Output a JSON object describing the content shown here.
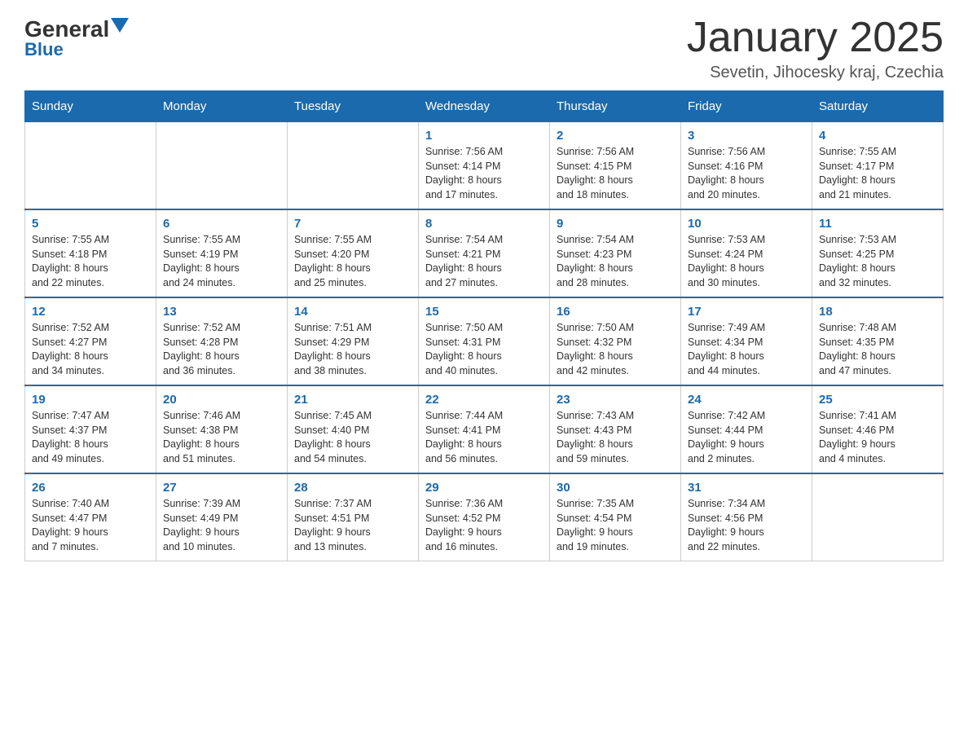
{
  "header": {
    "logo_general": "General",
    "logo_blue": "Blue",
    "month_title": "January 2025",
    "location": "Sevetin, Jihocesky kraj, Czechia"
  },
  "days_of_week": [
    "Sunday",
    "Monday",
    "Tuesday",
    "Wednesday",
    "Thursday",
    "Friday",
    "Saturday"
  ],
  "weeks": [
    {
      "cells": [
        {
          "day": null,
          "info": null
        },
        {
          "day": null,
          "info": null
        },
        {
          "day": null,
          "info": null
        },
        {
          "day": "1",
          "info": "Sunrise: 7:56 AM\nSunset: 4:14 PM\nDaylight: 8 hours\nand 17 minutes."
        },
        {
          "day": "2",
          "info": "Sunrise: 7:56 AM\nSunset: 4:15 PM\nDaylight: 8 hours\nand 18 minutes."
        },
        {
          "day": "3",
          "info": "Sunrise: 7:56 AM\nSunset: 4:16 PM\nDaylight: 8 hours\nand 20 minutes."
        },
        {
          "day": "4",
          "info": "Sunrise: 7:55 AM\nSunset: 4:17 PM\nDaylight: 8 hours\nand 21 minutes."
        }
      ]
    },
    {
      "cells": [
        {
          "day": "5",
          "info": "Sunrise: 7:55 AM\nSunset: 4:18 PM\nDaylight: 8 hours\nand 22 minutes."
        },
        {
          "day": "6",
          "info": "Sunrise: 7:55 AM\nSunset: 4:19 PM\nDaylight: 8 hours\nand 24 minutes."
        },
        {
          "day": "7",
          "info": "Sunrise: 7:55 AM\nSunset: 4:20 PM\nDaylight: 8 hours\nand 25 minutes."
        },
        {
          "day": "8",
          "info": "Sunrise: 7:54 AM\nSunset: 4:21 PM\nDaylight: 8 hours\nand 27 minutes."
        },
        {
          "day": "9",
          "info": "Sunrise: 7:54 AM\nSunset: 4:23 PM\nDaylight: 8 hours\nand 28 minutes."
        },
        {
          "day": "10",
          "info": "Sunrise: 7:53 AM\nSunset: 4:24 PM\nDaylight: 8 hours\nand 30 minutes."
        },
        {
          "day": "11",
          "info": "Sunrise: 7:53 AM\nSunset: 4:25 PM\nDaylight: 8 hours\nand 32 minutes."
        }
      ]
    },
    {
      "cells": [
        {
          "day": "12",
          "info": "Sunrise: 7:52 AM\nSunset: 4:27 PM\nDaylight: 8 hours\nand 34 minutes."
        },
        {
          "day": "13",
          "info": "Sunrise: 7:52 AM\nSunset: 4:28 PM\nDaylight: 8 hours\nand 36 minutes."
        },
        {
          "day": "14",
          "info": "Sunrise: 7:51 AM\nSunset: 4:29 PM\nDaylight: 8 hours\nand 38 minutes."
        },
        {
          "day": "15",
          "info": "Sunrise: 7:50 AM\nSunset: 4:31 PM\nDaylight: 8 hours\nand 40 minutes."
        },
        {
          "day": "16",
          "info": "Sunrise: 7:50 AM\nSunset: 4:32 PM\nDaylight: 8 hours\nand 42 minutes."
        },
        {
          "day": "17",
          "info": "Sunrise: 7:49 AM\nSunset: 4:34 PM\nDaylight: 8 hours\nand 44 minutes."
        },
        {
          "day": "18",
          "info": "Sunrise: 7:48 AM\nSunset: 4:35 PM\nDaylight: 8 hours\nand 47 minutes."
        }
      ]
    },
    {
      "cells": [
        {
          "day": "19",
          "info": "Sunrise: 7:47 AM\nSunset: 4:37 PM\nDaylight: 8 hours\nand 49 minutes."
        },
        {
          "day": "20",
          "info": "Sunrise: 7:46 AM\nSunset: 4:38 PM\nDaylight: 8 hours\nand 51 minutes."
        },
        {
          "day": "21",
          "info": "Sunrise: 7:45 AM\nSunset: 4:40 PM\nDaylight: 8 hours\nand 54 minutes."
        },
        {
          "day": "22",
          "info": "Sunrise: 7:44 AM\nSunset: 4:41 PM\nDaylight: 8 hours\nand 56 minutes."
        },
        {
          "day": "23",
          "info": "Sunrise: 7:43 AM\nSunset: 4:43 PM\nDaylight: 8 hours\nand 59 minutes."
        },
        {
          "day": "24",
          "info": "Sunrise: 7:42 AM\nSunset: 4:44 PM\nDaylight: 9 hours\nand 2 minutes."
        },
        {
          "day": "25",
          "info": "Sunrise: 7:41 AM\nSunset: 4:46 PM\nDaylight: 9 hours\nand 4 minutes."
        }
      ]
    },
    {
      "cells": [
        {
          "day": "26",
          "info": "Sunrise: 7:40 AM\nSunset: 4:47 PM\nDaylight: 9 hours\nand 7 minutes."
        },
        {
          "day": "27",
          "info": "Sunrise: 7:39 AM\nSunset: 4:49 PM\nDaylight: 9 hours\nand 10 minutes."
        },
        {
          "day": "28",
          "info": "Sunrise: 7:37 AM\nSunset: 4:51 PM\nDaylight: 9 hours\nand 13 minutes."
        },
        {
          "day": "29",
          "info": "Sunrise: 7:36 AM\nSunset: 4:52 PM\nDaylight: 9 hours\nand 16 minutes."
        },
        {
          "day": "30",
          "info": "Sunrise: 7:35 AM\nSunset: 4:54 PM\nDaylight: 9 hours\nand 19 minutes."
        },
        {
          "day": "31",
          "info": "Sunrise: 7:34 AM\nSunset: 4:56 PM\nDaylight: 9 hours\nand 22 minutes."
        },
        {
          "day": null,
          "info": null
        }
      ]
    }
  ]
}
